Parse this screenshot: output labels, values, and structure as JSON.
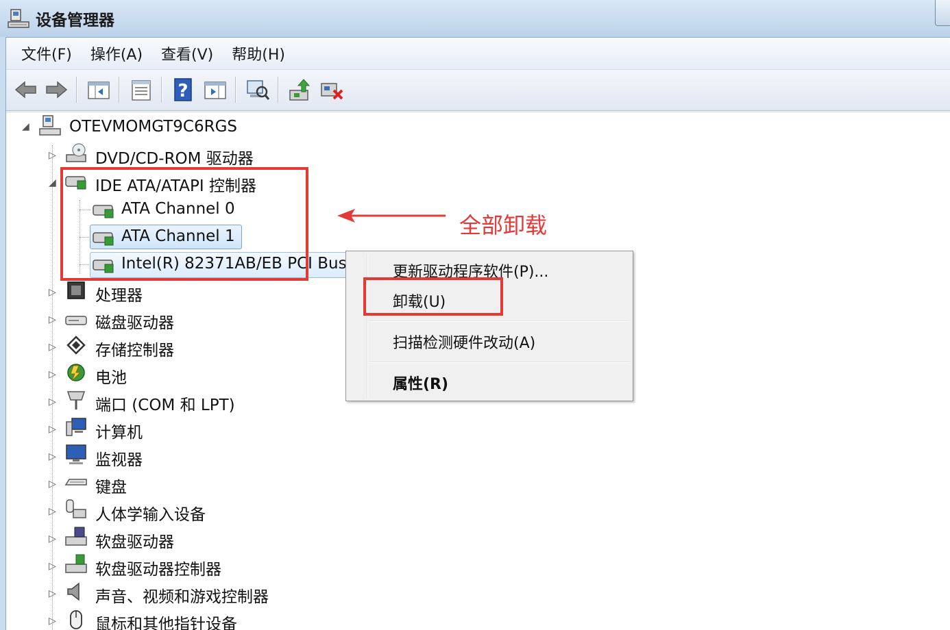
{
  "window": {
    "title": "设备管理器"
  },
  "menubar": {
    "items": [
      "文件(F)",
      "操作(A)",
      "查看(V)",
      "帮助(H)"
    ]
  },
  "toolbar": {
    "icons": [
      "back-arrow-icon",
      "forward-arrow-icon",
      "show-hide-tree-icon",
      "properties-icon",
      "help-icon",
      "view-icon",
      "scan-hardware-icon",
      "update-driver-icon",
      "uninstall-icon"
    ]
  },
  "tree": {
    "root": "OTEVMOMGT9C6RGS",
    "categories": [
      {
        "label": "DVD/CD-ROM 驱动器",
        "expander": "▷"
      },
      {
        "label": "IDE ATA/ATAPI 控制器",
        "expander": "◢"
      },
      {
        "label": "处理器",
        "expander": "▷"
      },
      {
        "label": "磁盘驱动器",
        "expander": "▷"
      },
      {
        "label": "存储控制器",
        "expander": "▷"
      },
      {
        "label": "电池",
        "expander": "▷"
      },
      {
        "label": "端口 (COM 和 LPT)",
        "expander": "▷"
      },
      {
        "label": "计算机",
        "expander": "▷"
      },
      {
        "label": "监视器",
        "expander": "▷"
      },
      {
        "label": "键盘",
        "expander": "▷"
      },
      {
        "label": "人体学输入设备",
        "expander": "▷"
      },
      {
        "label": "软盘驱动器",
        "expander": "▷"
      },
      {
        "label": "软盘驱动器控制器",
        "expander": "▷"
      },
      {
        "label": "声音、视频和游戏控制器",
        "expander": "▷"
      },
      {
        "label": "鼠标和其他指针设备",
        "expander": "▷"
      }
    ],
    "ide_children": [
      "ATA Channel 0",
      "ATA Channel 1",
      "Intel(R) 82371AB/EB PCI Bus"
    ]
  },
  "annotation": {
    "text": "全部卸载",
    "color": "#e53935"
  },
  "context_menu": {
    "items": [
      "更新驱动程序软件(P)...",
      "卸载(U)",
      "扫描检测硬件改动(A)",
      "属性(R)"
    ]
  }
}
